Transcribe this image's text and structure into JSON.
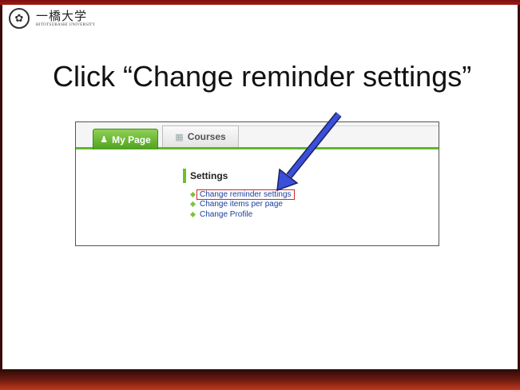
{
  "logo": {
    "crest_glyph": "✿",
    "jp": "一橋大学",
    "en": "HITOTSUBASHI UNIVERSITY"
  },
  "slide": {
    "title": "Click “Change reminder settings”"
  },
  "screenshot": {
    "tabs": [
      {
        "label": "My Page",
        "icon": "user-icon",
        "active": true
      },
      {
        "label": "Courses",
        "icon": "courses-icon",
        "active": false
      }
    ],
    "settings": {
      "heading": "Settings",
      "links": [
        {
          "label": "Change reminder settings",
          "highlighted": true
        },
        {
          "label": "Change items per page",
          "highlighted": false
        },
        {
          "label": "Change Profile",
          "highlighted": false
        }
      ]
    }
  },
  "colors": {
    "accent_green": "#5fb82a",
    "link_blue": "#1a3f9a",
    "highlight_red": "#e02020",
    "arrow_blue": "#3c4fd8",
    "frame_red": "#a31a12"
  }
}
